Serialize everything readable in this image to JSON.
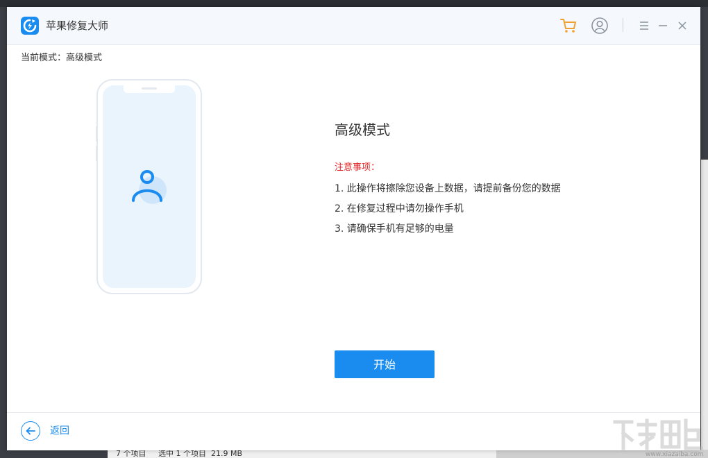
{
  "app": {
    "title": "苹果修复大师"
  },
  "titlebar": {
    "icons": [
      "cart-icon",
      "user-icon",
      "menu-icon",
      "minimize-icon",
      "close-icon"
    ]
  },
  "mode": {
    "label": "当前模式：",
    "value": "高级模式"
  },
  "main": {
    "heading": "高级模式",
    "notice_title": "注意事项：",
    "notices": [
      "1. 此操作将擦除您设备上数据，请提前备份您的数据",
      "2. 在修复过程中请勿操作手机",
      "3. 请确保手机有足够的电量"
    ],
    "start_label": "开始"
  },
  "footer": {
    "back_label": "返回"
  },
  "background": {
    "status_text": "7 个项目     选中 1 个项目  21.9 MB"
  },
  "watermark": {
    "text": "www.xiazaiba.com"
  },
  "colors": {
    "accent": "#1a8cf0",
    "warning": "#e02020",
    "cart": "#f0a030",
    "titlebar_bg": "#f5f9fd"
  }
}
